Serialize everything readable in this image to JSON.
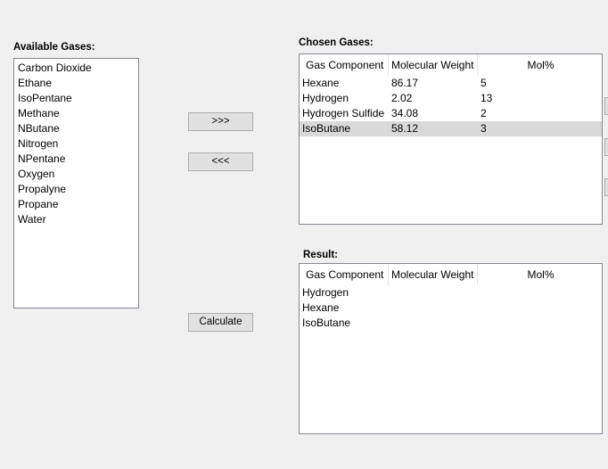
{
  "available": {
    "label": "Available Gases:",
    "items": [
      "Carbon Dioxide",
      "Ethane",
      "IsoPentane",
      "Methane",
      "NButane",
      "Nitrogen",
      "NPentane",
      "Oxygen",
      "Propalyne",
      "Propane",
      "Water"
    ]
  },
  "buttons": {
    "add": ">>>",
    "remove": "<<<",
    "calculate": "Calculate"
  },
  "chosen": {
    "label": "Chosen Gases:",
    "columns": [
      "Gas Component",
      "Molecular Weight",
      "Mol%"
    ],
    "rows": [
      {
        "gas": "Hexane",
        "mw": "86.17",
        "mol": "5"
      },
      {
        "gas": "Hydrogen",
        "mw": "2.02",
        "mol": "13"
      },
      {
        "gas": "Hydrogen Sulfide",
        "mw": "34.08",
        "mol": "2"
      },
      {
        "gas": "IsoButane",
        "mw": "58.12",
        "mol": "3",
        "selected": true
      }
    ]
  },
  "result": {
    "label": "Result:",
    "columns": [
      "Gas Component",
      "Molecular Weight",
      "Mol%"
    ],
    "rows": [
      {
        "gas": "Hydrogen"
      },
      {
        "gas": "Hexane"
      },
      {
        "gas": "IsoButane"
      }
    ]
  }
}
